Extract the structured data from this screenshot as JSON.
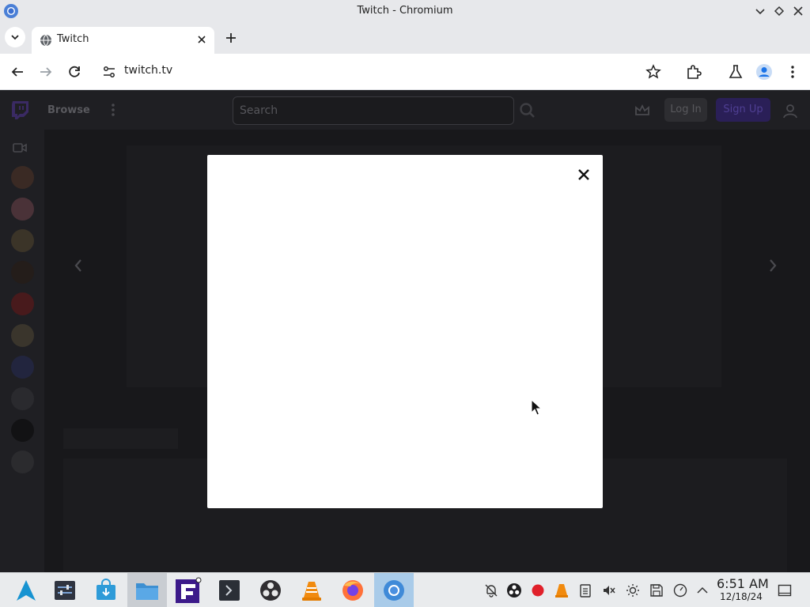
{
  "window": {
    "title": "Twitch - Chromium"
  },
  "tabs": [
    {
      "label": "Twitch",
      "active": true
    }
  ],
  "toolbar": {
    "url": "twitch.tv"
  },
  "twitch": {
    "nav": {
      "browse_label": "Browse",
      "search_placeholder": "Search",
      "login_label": "Log In",
      "signup_label": "Sign Up"
    },
    "sidebar_avatars": 10
  },
  "modal": {
    "close_icon": "close-icon"
  },
  "taskbar": {
    "apps": [
      "arch-launcher-icon",
      "settings-panel-icon",
      "software-store-icon",
      "file-manager-icon",
      "fenrir-app-icon",
      "terminal-icon",
      "obs-studio-icon",
      "vlc-icon",
      "firefox-icon",
      "chromium-icon"
    ],
    "clock": {
      "time": "6:51 AM",
      "date": "12/18/24"
    }
  },
  "colors": {
    "twitch_purple": "#9147ff",
    "chromium_blue": "#1a73e8",
    "page_bg": "#18181b"
  }
}
